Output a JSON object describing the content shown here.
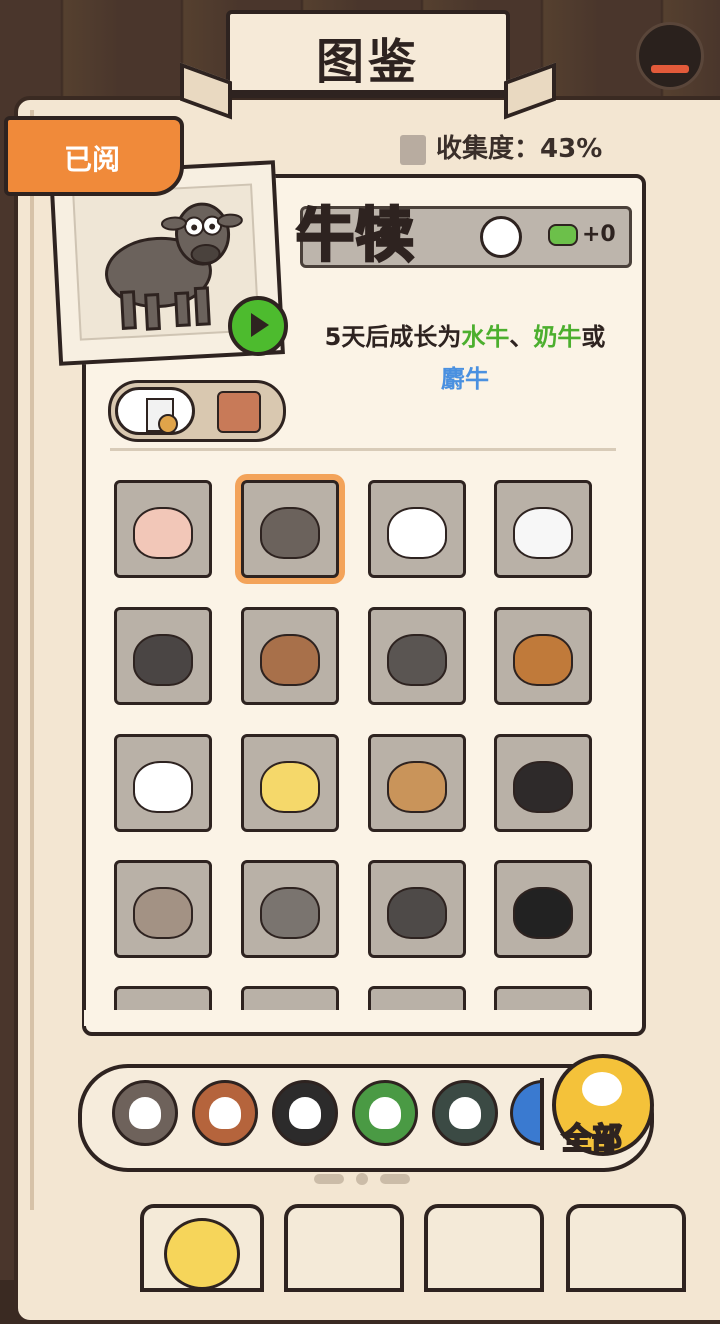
{
  "header": {
    "title": "图鉴"
  },
  "read_tag": {
    "label": "已阅"
  },
  "collection": {
    "label": "收集度：",
    "value": "43%"
  },
  "detail": {
    "name": "牛犊",
    "reward": "+0",
    "desc_prefix": "5天后成长为",
    "grow_1": "水牛",
    "sep_1": "、",
    "grow_2": "奶牛",
    "sep_2": "或",
    "grow_3": "麝牛"
  },
  "grid": {
    "items": [
      {
        "icon": "pig-icon",
        "color": "#f2c7b8"
      },
      {
        "icon": "calf-icon",
        "color": "#6b625c",
        "selected": true
      },
      {
        "icon": "sheep-icon",
        "color": "#ffffff"
      },
      {
        "icon": "lamb-icon",
        "color": "#f7f7f7"
      },
      {
        "icon": "boar-icon",
        "color": "#4a4544"
      },
      {
        "icon": "pony-icon",
        "color": "#a8704a"
      },
      {
        "icon": "donkey-icon",
        "color": "#5a5552"
      },
      {
        "icon": "rooster-icon",
        "color": "#c07a3a"
      },
      {
        "icon": "goose-icon",
        "color": "#ffffff"
      },
      {
        "icon": "chick-icon",
        "color": "#f5d86a"
      },
      {
        "icon": "hen-icon",
        "color": "#c9945a"
      },
      {
        "icon": "turkey-icon",
        "color": "#2e2a2a"
      },
      {
        "icon": "pigeon-icon",
        "color": "#a39284"
      },
      {
        "icon": "raccoon-icon",
        "color": "#7a746f"
      },
      {
        "icon": "wolf-icon",
        "color": "#4e4a48"
      },
      {
        "icon": "dog-icon",
        "color": "#222222"
      },
      {
        "icon": "fox-icon",
        "color": "#d6844a"
      },
      {
        "icon": "deer-icon",
        "color": "#a47a55"
      },
      {
        "icon": "horse-icon",
        "color": "#8a7f77"
      },
      {
        "icon": "cat-icon",
        "color": "#6b6560"
      }
    ]
  },
  "categories": [
    {
      "icon": "livestock-icon",
      "color": "#6e625b"
    },
    {
      "icon": "poultry-icon",
      "color": "#b5643c"
    },
    {
      "icon": "wild-icon",
      "color": "#2c2b2b"
    },
    {
      "icon": "plant-icon",
      "color": "#4a9a44"
    },
    {
      "icon": "pet-icon",
      "color": "#3b4a44"
    },
    {
      "icon": "water-icon",
      "color": "#3a7ad0"
    }
  ],
  "all_button": {
    "label": "全部"
  },
  "colors": {
    "accent": "#f08a3a",
    "green": "#4caf2e",
    "blue": "#4a90e0"
  }
}
